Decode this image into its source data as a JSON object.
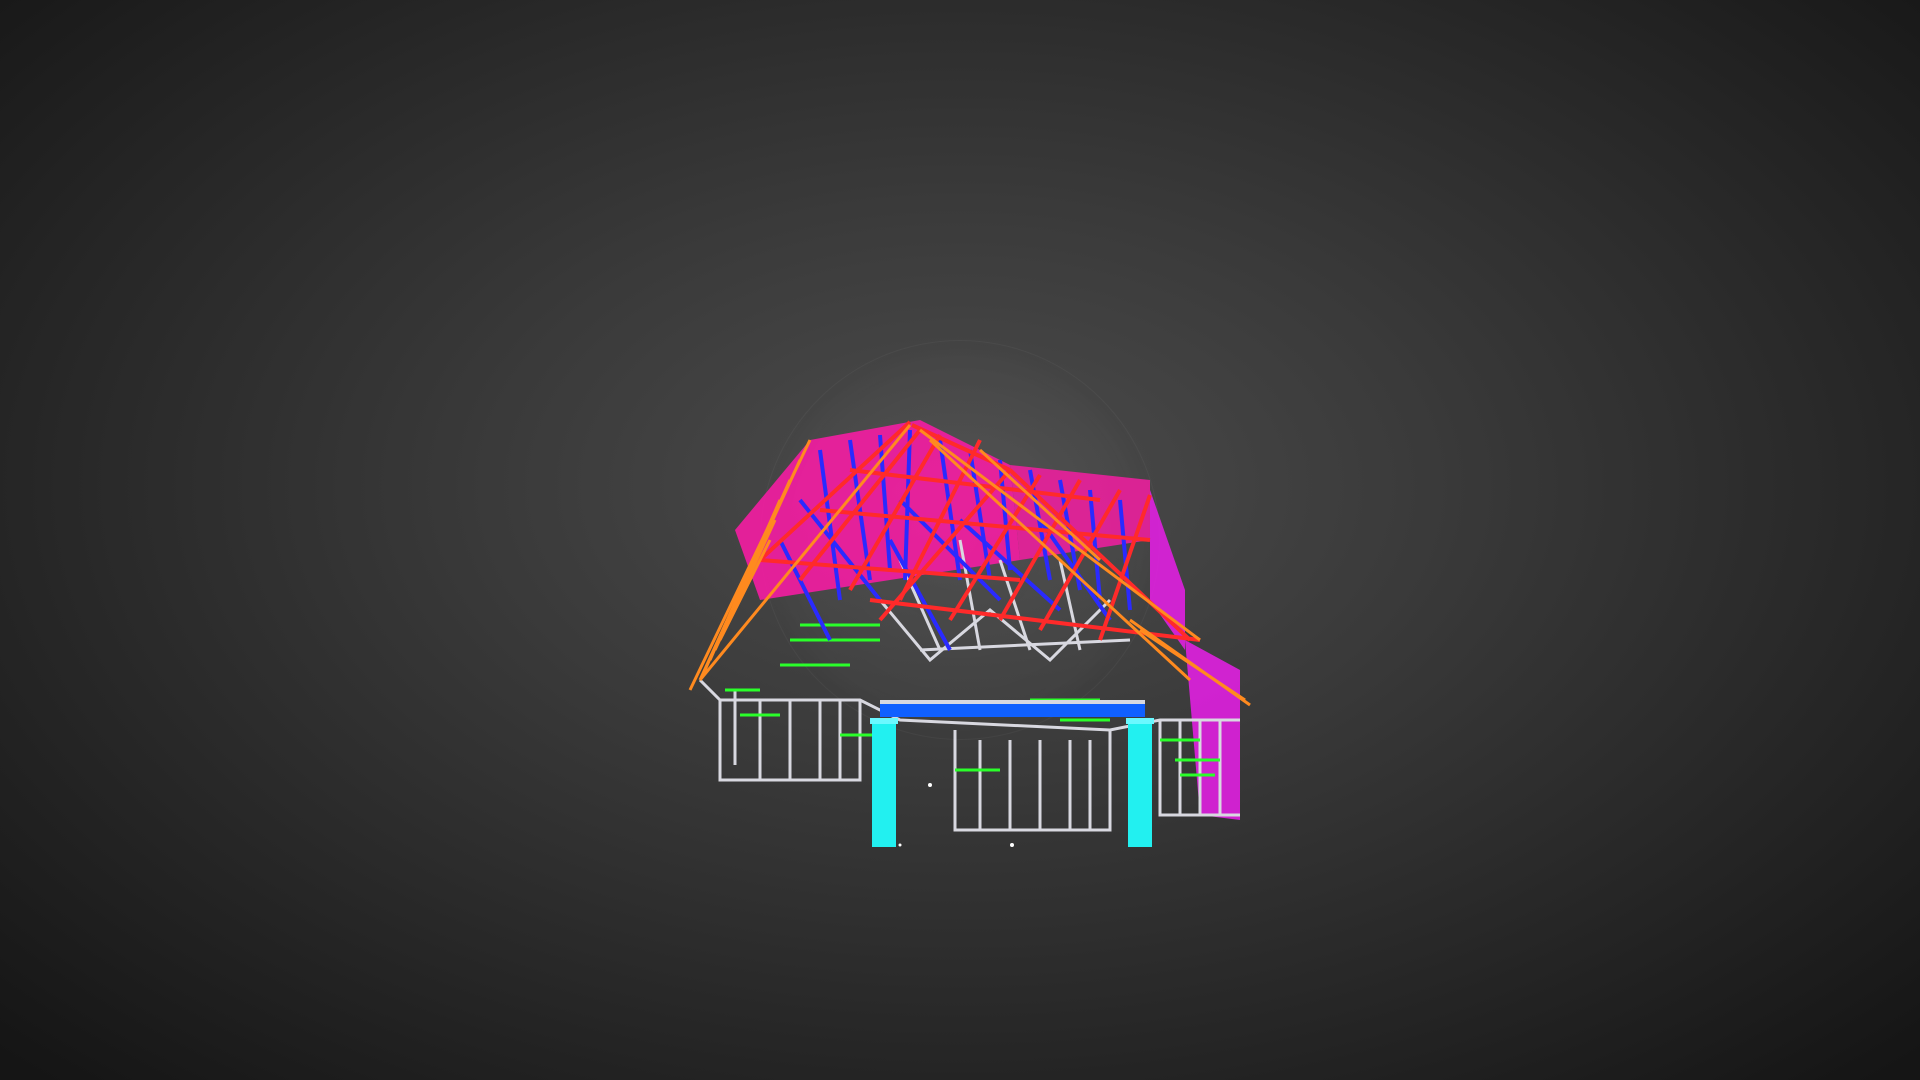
{
  "viewer": {
    "background_center": "#4c4c4c",
    "background_edge": "#151515"
  },
  "model": {
    "description_icon": "3d-building-frame-model",
    "colors": {
      "roof_face": "#ff1aa8",
      "rafter_red": "#ff2a2a",
      "rafter_orange": "#ff8a1f",
      "web_blue": "#2a2aff",
      "stud_white": "#d8d8e0",
      "nogging_green": "#2aff2a",
      "post_cyan": "#22f0f0",
      "wall_magenta": "#e020e0",
      "beam_blue": "#1060ff"
    }
  }
}
